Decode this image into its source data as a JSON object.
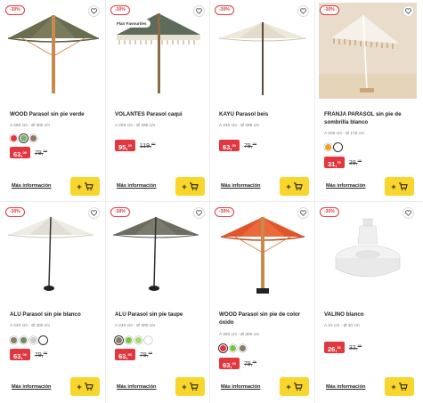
{
  "badge_label": "-30%",
  "fav_label": "Flair Favourites",
  "more_label": "Más información",
  "cart_plus": "+",
  "products": [
    {
      "title": "WOOD Parasol sin pie verde",
      "dims": "A 260 cm - Ø 300 cm",
      "price_main": "63,",
      "price_cents": "00",
      "old_main": "79,",
      "old_cents": "00",
      "swatches": [
        "#e2373f",
        "#7fb069",
        "#8a7a66"
      ],
      "selected": 1
    },
    {
      "title": "VOLANTES Parasol caqui",
      "dims": "A 263 cm - Ø 295 cm",
      "price_main": "95,",
      "price_cents": "20",
      "old_main": "119,",
      "old_cents": "00",
      "swatches": [],
      "selected": -1
    },
    {
      "title": "KAYU Parasol beis",
      "dims": "A 240 cm - Ø 296 cm",
      "price_main": "63,",
      "price_cents": "00",
      "old_main": "79,",
      "old_cents": "00",
      "swatches": [],
      "selected": -1
    },
    {
      "title": "FRANJA PARASOL sin pie de sombrilla blanco",
      "dims": "A 200 cm - Ø 178 cm",
      "price_main": "31,",
      "price_cents": "70",
      "old_main": "39,",
      "old_cents": "00",
      "swatches": [
        "#f0a020",
        "#ffffff"
      ],
      "selected": 1
    },
    {
      "title": "ALU Parasol sin pie blanco",
      "dims": "A 240 cm - Ø 300 cm",
      "price_main": "63,",
      "price_cents": "00",
      "old_main": "79,",
      "old_cents": "00",
      "swatches": [
        "#8a7a66",
        "#6b8e5a",
        "#cccccc",
        "#ffffff"
      ],
      "selected": 3
    },
    {
      "title": "ALU Parasol sin pie taupe",
      "dims": "A 240 cm - Ø 300 cm",
      "price_main": "63,",
      "price_cents": "00",
      "old_main": "79,",
      "old_cents": "00",
      "swatches": [
        "#8a7a66",
        "#7fc241",
        "#a8d86e",
        "#ffffff"
      ],
      "selected": 0
    },
    {
      "title": "WOOD Parasol sin pie de color óxido",
      "dims": "A 260 cm - Ø 300 cm",
      "price_main": "63,",
      "price_cents": "00",
      "old_main": "79,",
      "old_cents": "00",
      "swatches": [
        "#e2373f",
        "#7fc241",
        "#8a7a66"
      ],
      "selected": 0
    },
    {
      "title": "VALINO blanco",
      "dims": "A 10 cm - Ø 40 cm",
      "price_main": "26,",
      "price_cents": "36",
      "old_main": "32,",
      "old_cents": "95",
      "swatches": [],
      "selected": -1
    }
  ],
  "colors": {
    "sale_red": "#e2373f",
    "cart_yellow": "#f9d62b"
  }
}
